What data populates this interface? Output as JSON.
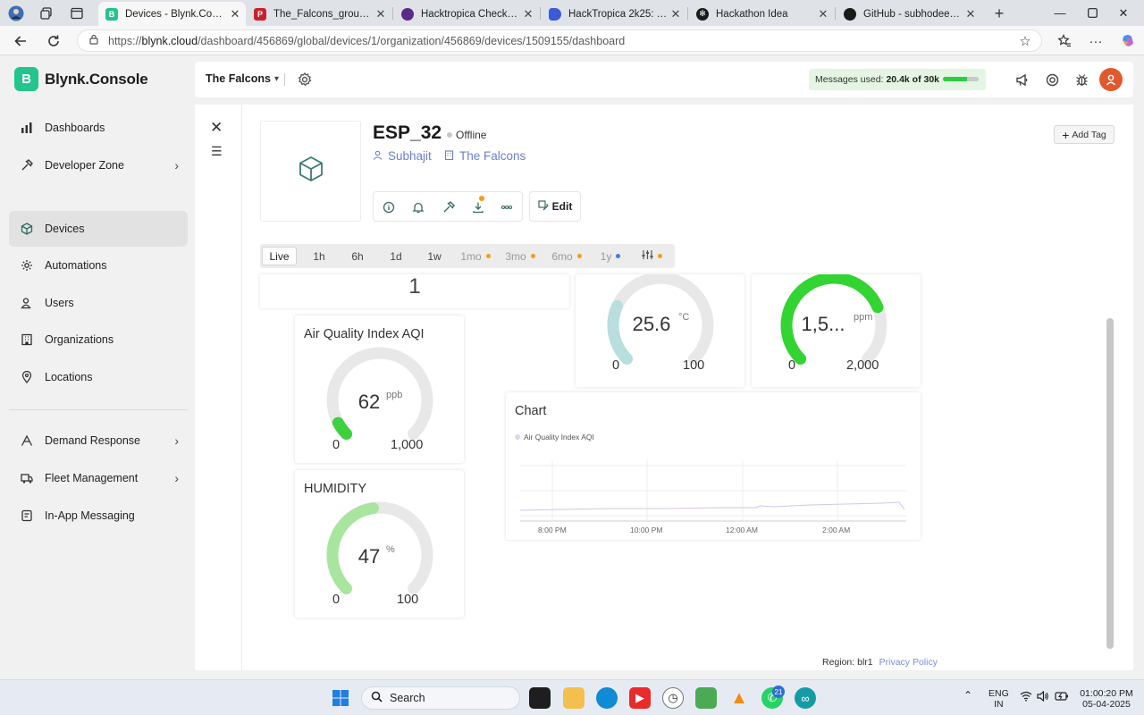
{
  "browser": {
    "tabs": [
      {
        "label": "Devices - Blynk.Console",
        "active": true
      },
      {
        "label": "The_Falcons_group[1].pdf"
      },
      {
        "label": "Hacktropica Checkpoint U"
      },
      {
        "label": "HackTropica 2k25: Dashb"
      },
      {
        "label": "Hackathon Idea"
      },
      {
        "label": "GitHub - subhodeepmaje"
      }
    ],
    "url_prefix": "https://",
    "url_host": "blynk.cloud",
    "url_path": "/dashboard/456869/global/devices/1/organization/456869/devices/1509155/dashboard"
  },
  "brand": {
    "letter": "B",
    "name": "Blynk.Console",
    "color": "#23c48e"
  },
  "sidebar": {
    "items": [
      {
        "label": "Dashboards",
        "icon": "dashboard-icon"
      },
      {
        "label": "Developer Zone",
        "icon": "tools-icon",
        "chevron": true
      },
      {
        "label": "Devices",
        "icon": "cube-icon",
        "active": true
      },
      {
        "label": "Automations",
        "icon": "automation-icon"
      },
      {
        "label": "Users",
        "icon": "users-icon"
      },
      {
        "label": "Organizations",
        "icon": "building-icon"
      },
      {
        "label": "Locations",
        "icon": "location-pin-icon"
      },
      {
        "label": "Demand Response",
        "icon": "demand-response-icon",
        "chevron": true
      },
      {
        "label": "Fleet Management",
        "icon": "truck-icon",
        "chevron": true
      },
      {
        "label": "In-App Messaging",
        "icon": "message-icon"
      }
    ]
  },
  "topbar": {
    "org_name": "The Falcons",
    "messages_label": "Messages used:",
    "messages_value": "20.4k of 30k",
    "messages_fraction": 0.68
  },
  "device": {
    "name": "ESP_32",
    "status": "Offline",
    "owner": "Subhajit",
    "org": "The Falcons",
    "edit_label": "Edit",
    "add_tag_label": "Add Tag"
  },
  "ranges": [
    "Live",
    "1h",
    "6h",
    "1d",
    "1w",
    "1mo",
    "3mo",
    "6mo",
    "1y"
  ],
  "widgets": {
    "counter": {
      "value": "1"
    },
    "aqi": {
      "title": "Air Quality Index AQI",
      "value": "62",
      "unit": "ppb",
      "min": "0",
      "max": "1,000",
      "fraction": 0.062,
      "color": "#3fcf3f"
    },
    "humidity": {
      "title": "HUMIDITY",
      "value": "47",
      "unit": "%",
      "min": "0",
      "max": "100",
      "fraction": 0.47,
      "color": "#a8e6a0"
    },
    "temperature": {
      "value": "25.6",
      "unit": "°C",
      "min": "0",
      "max": "100",
      "fraction": 0.256,
      "color": "#b9dede"
    },
    "gas": {
      "value": "1,5...",
      "unit": "ppm",
      "min": "0",
      "max": "2,000",
      "fraction": 0.75,
      "color": "#32d432"
    },
    "chart": {
      "title": "Chart",
      "legend": "Air Quality Index AQI",
      "xticks": [
        "8:00 PM",
        "10:00 PM",
        "12:00 AM",
        "2:00 AM"
      ]
    }
  },
  "footer": {
    "region": "Region: blr1",
    "privacy": "Privacy Policy"
  },
  "taskbar": {
    "search": "Search",
    "lang_top": "ENG",
    "lang_bottom": "IN",
    "time": "01:00:20 PM",
    "date": "05-04-2025",
    "whatsapp_badge": "21"
  }
}
